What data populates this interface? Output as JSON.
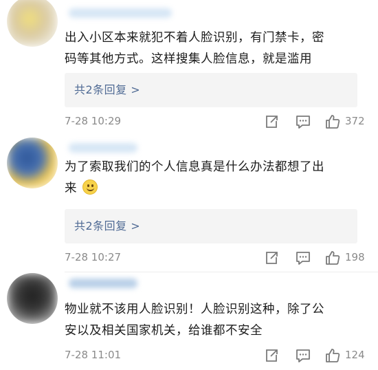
{
  "comments": [
    {
      "text_line1": "出入小区本来就犯不着人脸识别，有门禁卡，密",
      "text_line2": "码等其他方式。这样搜集人脸信息，就是滥用",
      "replies_label": "共2条回复 >",
      "time": "7-28 10:29",
      "likes": "372",
      "avatar_colors": [
        "#d9c9a0",
        "#f2e07a",
        "#ffffff"
      ],
      "name_color": "#cfe1f3"
    },
    {
      "text_line1": "为了索取我们的个人信息真是什么办法都想了出",
      "text_line2": "来",
      "replies_label": "共2条回复 >",
      "time": "7-28 10:27",
      "likes": "198",
      "avatar_colors": [
        "#3a5f9c",
        "#f0c64a",
        "#ffffff"
      ],
      "name_color": "#cfe1f3"
    },
    {
      "text_line1": "物业就不该用人脸识别！人脸识别这种，除了公",
      "text_line2": "安以及相关国家机关，给谁都不安全",
      "time": "7-28 11:01",
      "likes": "124",
      "avatar_colors": [
        "#2c2c2c",
        "#6a6a6a",
        "#ffffff"
      ],
      "name_color": "#9fbddc"
    }
  ],
  "icons": {
    "share": "share-icon",
    "comment": "comment-icon",
    "like": "thumbs-up-icon"
  }
}
